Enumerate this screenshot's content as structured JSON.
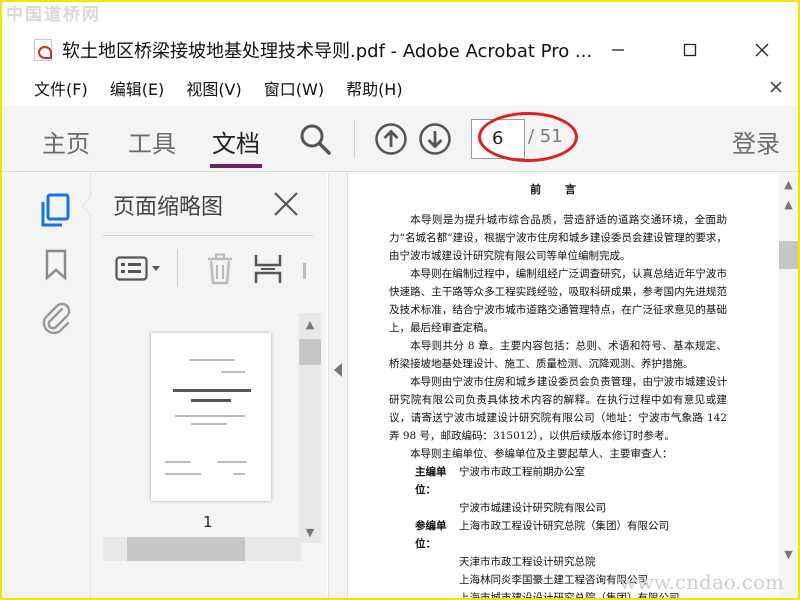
{
  "watermarks": {
    "top": "中国道桥网",
    "bottom": "www.cndao.com"
  },
  "window": {
    "title": "软土地区桥梁接坡地基处理技术导则.pdf - Adobe Acrobat Pro ..."
  },
  "menu": {
    "items": [
      "文件(F)",
      "编辑(E)",
      "视图(V)",
      "窗口(W)",
      "帮助(H)"
    ]
  },
  "toolbar": {
    "tabs": [
      "主页",
      "工具",
      "文档"
    ],
    "active_tab": "文档",
    "current_page": "6",
    "total_pages": "/ 51",
    "login": "登录"
  },
  "thumbnail_panel": {
    "title": "页面缩略图",
    "page_number": "1"
  },
  "document": {
    "heading": "前 言",
    "paragraphs": [
      "本导则是为提升城市综合品质，营造舒适的道路交通环境，全面助力“名城名都”建设，根据宁波市住房和城乡建设委员会建设管理的要求，由宁波市城建设计研究院有限公司等单位编制完成。",
      "本导则在编制过程中，编制组经广泛调查研究，认真总结近年宁波市快速路、主干路等众多工程实践经验，吸取科研成果，参考国内先进规范及技术标准，结合宁波市城市道路交通管理特点，在广泛征求意见的基础上，最后经审查定稿。",
      "本导则共分 8 章。主要内容包括：总则、术语和符号、基本规定、桥梁接坡地基处理设计、施工、质量检测、沉降观测、养护措施。",
      "本导则由宁波市住房和城乡建设委员会负责管理，由宁波市城建设计研究院有限公司负责具体技术内容的解释。在执行过程中如有意见或建议，请寄送宁波市城建设计研究院有限公司（地址：宁波市气象路 142 弄 98 号，邮政编码：315012），以供后续版本修订时参考。",
      "本导则主编单位、参编单位及主要起草人、主要审查人："
    ],
    "chief_label": "主编单位：",
    "chief_units": [
      "宁波市市政工程前期办公室",
      "宁波市城建设计研究院有限公司"
    ],
    "participant_label": "参编单位：",
    "participant_units": [
      "上海市政工程设计研究总院（集团）有限公司",
      "天津市市政工程设计研究总院",
      "上海林同炎李国豪土建工程咨询有限公司",
      "上海市城市建设设计研究总院（集团）有限公司"
    ]
  },
  "colors": {
    "frame": "#f2e600",
    "accent_purple": "#6e1f6b",
    "annotation_red": "#e02020",
    "rail_icon_blue": "#1473e6"
  }
}
